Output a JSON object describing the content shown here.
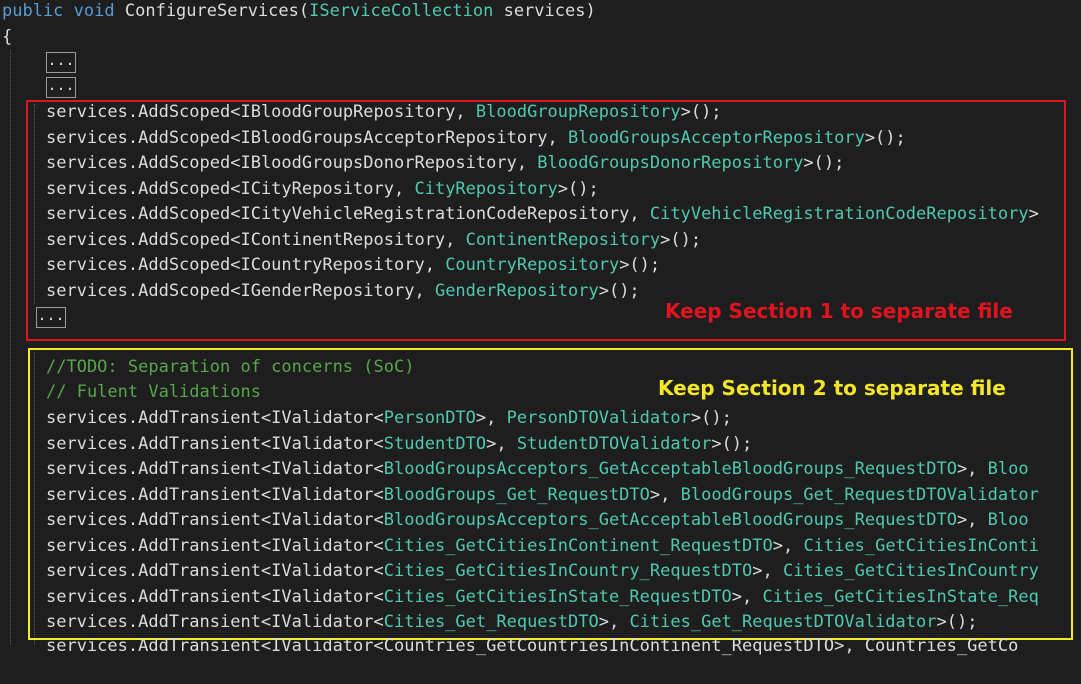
{
  "editor": {
    "signature": {
      "kw1": "public",
      "kw2": "void",
      "name": "ConfigureServices(",
      "param_type": "IServiceCollection",
      "param_name": " services)"
    },
    "open_brace": "{",
    "collapsed_label": "..."
  },
  "section1": {
    "note": "Keep Section 1 to separate file",
    "lines": [
      {
        "prefix": "services.AddScoped<",
        "t1": "IBloodGroupRepository",
        "sep": ", ",
        "t2": "BloodGroupRepository",
        "suffix": ">();"
      },
      {
        "prefix": "services.AddScoped<",
        "t1": "IBloodGroupsAcceptorRepository",
        "sep": ", ",
        "t2": "BloodGroupsAcceptorRepository",
        "suffix": ">();"
      },
      {
        "prefix": "services.AddScoped<",
        "t1": "IBloodGroupsDonorRepository",
        "sep": ", ",
        "t2": "BloodGroupsDonorRepository",
        "suffix": ">();"
      },
      {
        "prefix": "services.AddScoped<",
        "t1": "ICityRepository",
        "sep": ", ",
        "t2": "CityRepository",
        "suffix": ">();"
      },
      {
        "prefix": "services.AddScoped<",
        "t1": "ICityVehicleRegistrationCodeRepository",
        "sep": ", ",
        "t2": "CityVehicleRegistrationCodeRepository",
        "suffix": ">"
      },
      {
        "prefix": "services.AddScoped<",
        "t1": "IContinentRepository",
        "sep": ", ",
        "t2": "ContinentRepository",
        "suffix": ">();"
      },
      {
        "prefix": "services.AddScoped<",
        "t1": "ICountryRepository",
        "sep": ", ",
        "t2": "CountryRepository",
        "suffix": ">();"
      },
      {
        "prefix": "services.AddScoped<",
        "t1": "IGenderRepository",
        "sep": ", ",
        "t2": "GenderRepository",
        "suffix": ">();"
      }
    ]
  },
  "section2": {
    "note": "Keep Section 2 to separate file",
    "comment1": "//TODO: Separation of concerns (SoC)",
    "comment2": "// Fulent Validations",
    "lines": [
      {
        "prefix": "services.AddTransient<",
        "t1": "IValidator",
        "mid": "<",
        "t2": "PersonDTO",
        "sep": ">, ",
        "t3": "PersonDTOValidator",
        "suffix": ">();"
      },
      {
        "prefix": "services.AddTransient<",
        "t1": "IValidator",
        "mid": "<",
        "t2": "StudentDTO",
        "sep": ">, ",
        "t3": "StudentDTOValidator",
        "suffix": ">();"
      },
      {
        "prefix": "services.AddTransient<",
        "t1": "IValidator",
        "mid": "<",
        "t2": "BloodGroupsAcceptors_GetAcceptableBloodGroups_RequestDTO",
        "sep": ">, ",
        "t3": "Bloo",
        "suffix": ""
      },
      {
        "prefix": "services.AddTransient<",
        "t1": "IValidator",
        "mid": "<",
        "t2": "BloodGroups_Get_RequestDTO",
        "sep": ">, ",
        "t3": "BloodGroups_Get_RequestDTOValidator",
        "suffix": ""
      },
      {
        "prefix": "services.AddTransient<",
        "t1": "IValidator",
        "mid": "<",
        "t2": "BloodGroupsAcceptors_GetAcceptableBloodGroups_RequestDTO",
        "sep": ">, ",
        "t3": "Bloo",
        "suffix": ""
      },
      {
        "prefix": "services.AddTransient<",
        "t1": "IValidator",
        "mid": "<",
        "t2": "Cities_GetCitiesInContinent_RequestDTO",
        "sep": ">, ",
        "t3": "Cities_GetCitiesInConti",
        "suffix": ""
      },
      {
        "prefix": "services.AddTransient<",
        "t1": "IValidator",
        "mid": "<",
        "t2": "Cities_GetCitiesInCountry_RequestDTO",
        "sep": ">, ",
        "t3": "Cities_GetCitiesInCountry",
        "suffix": ""
      },
      {
        "prefix": "services.AddTransient<",
        "t1": "IValidator",
        "mid": "<",
        "t2": "Cities_GetCitiesInState_RequestDTO",
        "sep": ">, ",
        "t3": "Cities_GetCitiesInState_Req",
        "suffix": ""
      },
      {
        "prefix": "services.AddTransient<",
        "t1": "IValidator",
        "mid": "<",
        "t2": "Cities_Get_RequestDTO",
        "sep": ">, ",
        "t3": "Cities_Get_RequestDTOValidator",
        "suffix": ">();"
      }
    ],
    "partial_last": "services.AddTransient<IValidator<Countries_GetCountriesInContinent_RequestDTO>, Countries_GetCo"
  }
}
